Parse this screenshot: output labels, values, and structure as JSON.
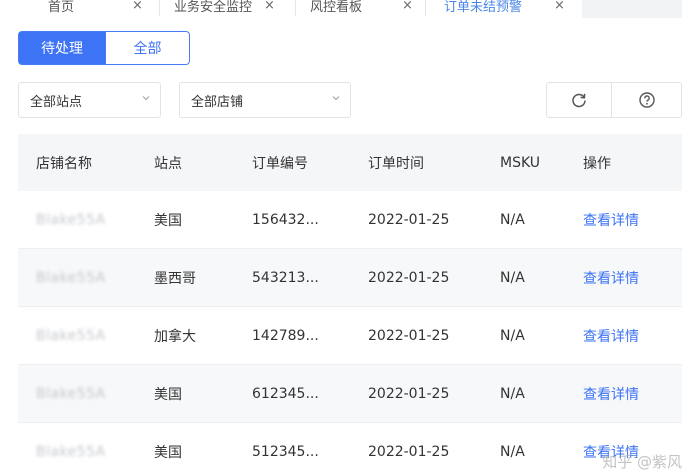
{
  "tabs": [
    {
      "label": "首页",
      "active": false
    },
    {
      "label": "业务安全监控",
      "active": false
    },
    {
      "label": "风控看板",
      "active": false
    },
    {
      "label": "订单未结预警",
      "active": true
    }
  ],
  "tab_close_glyph": "×",
  "segments": {
    "pending": "待处理",
    "all": "全部"
  },
  "filters": {
    "site": "全部站点",
    "store": "全部店铺"
  },
  "icons": {
    "refresh": "refresh-icon",
    "help": "question-circle-icon"
  },
  "table": {
    "headers": [
      "店铺名称",
      "站点",
      "订单编号",
      "订单时间",
      "MSKU",
      "操作"
    ],
    "rows": [
      {
        "store": "Blake55A",
        "site": "美国",
        "order_no": "156432...",
        "date": "2022-01-25",
        "msku": "N/A",
        "action": "查看详情"
      },
      {
        "store": "Blake55A",
        "site": "墨西哥",
        "order_no": "543213...",
        "date": "2022-01-25",
        "msku": "N/A",
        "action": "查看详情"
      },
      {
        "store": "Blake55A",
        "site": "加拿大",
        "order_no": "142789...",
        "date": "2022-01-25",
        "msku": "N/A",
        "action": "查看详情"
      },
      {
        "store": "Blake55A",
        "site": "美国",
        "order_no": "612345...",
        "date": "2022-01-25",
        "msku": "N/A",
        "action": "查看详情"
      },
      {
        "store": "Blake55A",
        "site": "美国",
        "order_no": "512345...",
        "date": "2022-01-25",
        "msku": "N/A",
        "action": "查看详情"
      }
    ]
  },
  "watermark": "知乎 @紫风",
  "colors": {
    "primary": "#3d73f5",
    "header_bg": "#f5f6f8",
    "alt_row": "#f7f8fa"
  }
}
